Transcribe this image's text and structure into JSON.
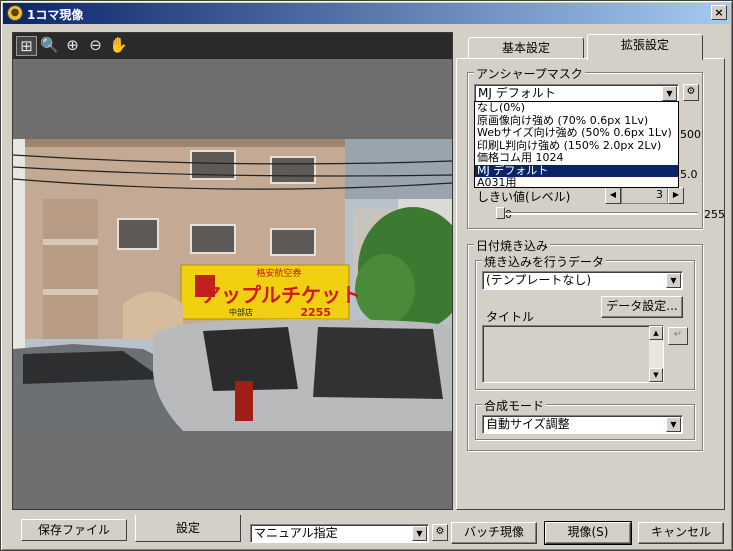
{
  "window": {
    "title": "1コマ現像",
    "close_glyph": "×"
  },
  "preview_toolbar": {
    "tools": [
      {
        "name": "fit-view-icon",
        "glyph": "⊞"
      },
      {
        "name": "zoom-icon",
        "glyph": "🔍"
      },
      {
        "name": "zoom-in-icon",
        "glyph": "⊕"
      },
      {
        "name": "zoom-out-icon",
        "glyph": "⊖"
      },
      {
        "name": "hand-pan-icon",
        "glyph": "✋"
      }
    ]
  },
  "photo": {
    "sign_main": "アップルチケット",
    "sign_top": "格安航空券",
    "sign_phone": "2255",
    "sign_address": "中部店"
  },
  "tabs": {
    "basic": "基本設定",
    "extended": "拡張設定"
  },
  "unsharp": {
    "group_label": "アンシャープマスク",
    "selected": "MJ デフォルト",
    "options": [
      "なし(0%)",
      "原画像向け強め (70% 0.6px 1Lv)",
      "Webサイズ向け強め (50% 0.6px 1Lv)",
      "印刷L判向け強め (150% 2.0px 2Lv)",
      "価格コム用 1024",
      "MJ デフォルト",
      "A031用"
    ],
    "selected_index": 5,
    "hidden_value_a": "500",
    "hidden_value_b": "5.0",
    "threshold_label": "しきい値(レベル)",
    "threshold_value": "3",
    "threshold_min": "0",
    "threshold_max": "255",
    "threshold_level": 3
  },
  "date_imprint": {
    "group_label": "日付焼き込み",
    "data_label": "焼き込みを行うデータ",
    "data_selected": "(テンプレートなし)",
    "data_settings_button": "データ設定...",
    "title_label": "タイトル",
    "enter_glyph": "↵"
  },
  "composite": {
    "group_label": "合成モード",
    "selected": "自動サイズ調整"
  },
  "bottom": {
    "tab_save": "保存ファイル",
    "tab_settings": "設定",
    "preset_selected": "マニュアル指定",
    "batch_button": "バッチ現像",
    "develop_button": "現像(S)",
    "cancel_button": "キャンセル",
    "gear_glyph": "⚙"
  }
}
